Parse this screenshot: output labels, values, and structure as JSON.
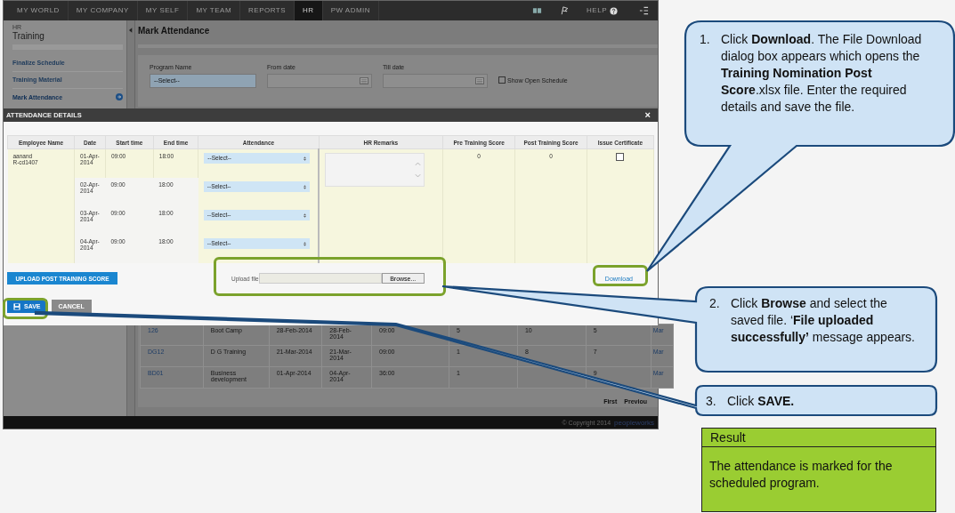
{
  "nav": {
    "items": [
      {
        "label": "MY WORLD",
        "selected": false
      },
      {
        "label": "MY COMPANY",
        "selected": false
      },
      {
        "label": "MY SELF",
        "selected": false
      },
      {
        "label": "MY TEAM",
        "selected": false
      },
      {
        "label": "REPORTS",
        "selected": false
      },
      {
        "label": "HR",
        "selected": true
      },
      {
        "label": "PW ADMIN",
        "selected": false
      }
    ],
    "help": "HELP"
  },
  "sidebar": {
    "section": "HR",
    "title": "Training",
    "items": [
      {
        "label": "Finalize Schedule",
        "selected": false
      },
      {
        "label": "Training Material",
        "selected": false
      },
      {
        "label": "Mark Attendance",
        "selected": true
      }
    ]
  },
  "page_title": "Mark Attendance",
  "filters": {
    "program_label": "Program Name",
    "program_value": "--Select--",
    "from_label": "From date",
    "till_label": "Till date",
    "show_open": {
      "label": "Show Open Schedule",
      "checked": false
    }
  },
  "schedule_rows": [
    {
      "code": "126",
      "name": "Boot Camp",
      "start_date": "28-Feb-2014",
      "end_date": "28-Feb-2014",
      "duration": "09:00",
      "col_6": "5",
      "col_7": "10",
      "col_8": "5",
      "action": "Mar"
    },
    {
      "code": "DG12",
      "name": "D G Training",
      "start_date": "21-Mar-2014",
      "end_date": "21-Mar-2014",
      "duration": "09:00",
      "col_6": "1",
      "col_7": "8",
      "col_8": "7",
      "action": "Mar"
    },
    {
      "code": "BD01",
      "name": "Business development",
      "start_date": "01-Apr-2014",
      "end_date": "04-Apr-2014",
      "duration": "36:00",
      "col_6": "1",
      "col_7": "",
      "col_8": "9",
      "action": "Mar"
    }
  ],
  "pagination": [
    "First",
    "Previou"
  ],
  "footer": {
    "copyright": "© Copyright 2014",
    "logo": "peopleworks"
  },
  "dialog": {
    "title": "ATTENDANCE DETAILS",
    "close": "×",
    "columns": [
      "Employee Name",
      "Date",
      "Start time",
      "End time",
      "Attendance",
      "HR Remarks",
      "Pre Training Score",
      "Post Training Score",
      "Issue Certificate"
    ],
    "employee": {
      "name": "aanand",
      "id": "R-cd1407"
    },
    "days": [
      {
        "date": "01-Apr-2014",
        "start": "09:00",
        "end": "18:00",
        "attendance": "--Select--"
      },
      {
        "date": "02-Apr-2014",
        "start": "09:00",
        "end": "18:00",
        "attendance": "--Select--"
      },
      {
        "date": "03-Apr-2014",
        "start": "09:00",
        "end": "18:00",
        "attendance": "--Select--"
      },
      {
        "date": "04-Apr-2014",
        "start": "09:00",
        "end": "18:00",
        "attendance": "--Select--"
      }
    ],
    "pre_score": "0",
    "post_score": "0",
    "issue_certificate": {
      "checked": false
    },
    "upload_button": "UPLOAD POST TRAINING SCORE",
    "upload_label": "Upload file",
    "browse": "Browse...",
    "download": "Download",
    "save": "SAVE",
    "cancel": "CANCEL"
  },
  "callouts": [
    {
      "number": "1.",
      "text": "Click **Download**. The File Download dialog box appears which opens the **Training Nomination Post Score**.xlsx file. Enter the required details and save the file."
    },
    {
      "number": "2.",
      "text": "Click **Browse** and select the saved file. ‘**File uploaded successfully’** message appears."
    },
    {
      "number": "3.",
      "text": "Click **SAVE.**"
    }
  ],
  "result": {
    "title": "Result",
    "text": "The attendance is marked for the scheduled program."
  }
}
